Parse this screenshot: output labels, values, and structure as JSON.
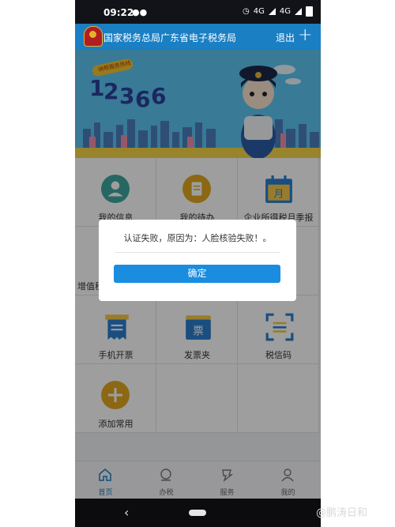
{
  "status_bar": {
    "time": "09:22",
    "network_1": "4G",
    "network_2": "4G"
  },
  "header": {
    "title": "国家税务总局广东省电子税务局",
    "logout": "退出",
    "add_icon": "plus-icon"
  },
  "banner": {
    "tagline": "纳税服务热线",
    "hotline": "12366"
  },
  "grid": {
    "items": [
      {
        "label": "我的信息",
        "icon": "user-icon",
        "color": "#3fa6a0"
      },
      {
        "label": "我的待办",
        "icon": "document-icon",
        "color": "#e2a821"
      },
      {
        "label": "企业所得税月季报",
        "icon": "calendar-icon",
        "color": "#2a7fd0"
      },
      {
        "label": "增值税",
        "icon": "tax-icon",
        "color": "#2a7fd0"
      },
      {
        "label": "",
        "icon": "",
        "color": "#ffffff"
      },
      {
        "label": "",
        "icon": "",
        "color": "#ffffff"
      },
      {
        "label": "手机开票",
        "icon": "invoice-icon",
        "color": "#2a7fd0"
      },
      {
        "label": "发票夹",
        "icon": "invoice-folder-icon",
        "color": "#2a7fd0"
      },
      {
        "label": "税信码",
        "icon": "qr-scan-icon",
        "color": "#2a7fd0"
      },
      {
        "label": "添加常用",
        "icon": "add-icon",
        "color": "#e2a821"
      }
    ],
    "invoice_folder_glyph": "票",
    "calendar_glyph": "月"
  },
  "dialog": {
    "message": "认证失败，原因为：人脸核验失败！。",
    "confirm": "确定"
  },
  "bottom_nav": [
    {
      "label": "首页",
      "icon": "home-icon",
      "active": true
    },
    {
      "label": "办税",
      "icon": "tax-coin-icon",
      "active": false
    },
    {
      "label": "服务",
      "icon": "service-icon",
      "active": false
    },
    {
      "label": "我的",
      "icon": "profile-icon",
      "active": false
    }
  ],
  "watermark": "@鹏涛日和",
  "colors": {
    "primary": "#1a7fc3",
    "accent": "#e2a821",
    "button": "#1a8de0"
  }
}
